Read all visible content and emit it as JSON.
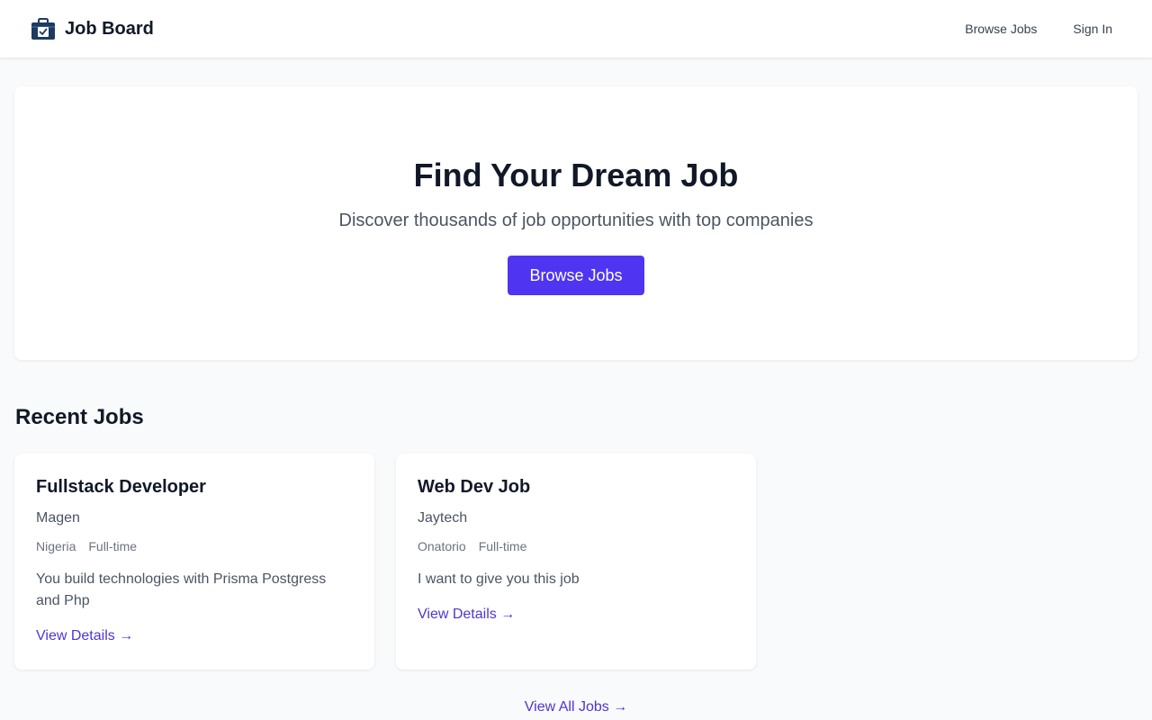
{
  "navbar": {
    "brand_name": "Job Board",
    "brand_icon": "briefcase-icon",
    "links": [
      {
        "label": "Browse Jobs"
      },
      {
        "label": "Sign In"
      }
    ]
  },
  "hero": {
    "title": "Find Your Dream Job",
    "subtitle": "Discover thousands of job opportunities with top companies",
    "button_label": "Browse Jobs"
  },
  "recent_jobs": {
    "title": "Recent Jobs",
    "jobs": [
      {
        "title": "Fullstack Developer",
        "company": "Magen",
        "location": "Nigeria",
        "type": "Full-time",
        "description": "You build technologies with Prisma Postgress and Php",
        "link_label": "View Details →"
      },
      {
        "title": "Web Dev Job",
        "company": "Jaytech",
        "location": "Onatorio",
        "type": "Full-time",
        "description": "I want to give you this job",
        "link_label": "View Details →"
      }
    ],
    "view_all_label": "View All Jobs →"
  },
  "colors": {
    "accent": "#4f35f2",
    "link": "#4f35d2",
    "brand_icon": "#1e3a5f",
    "background": "#f9fafb"
  }
}
